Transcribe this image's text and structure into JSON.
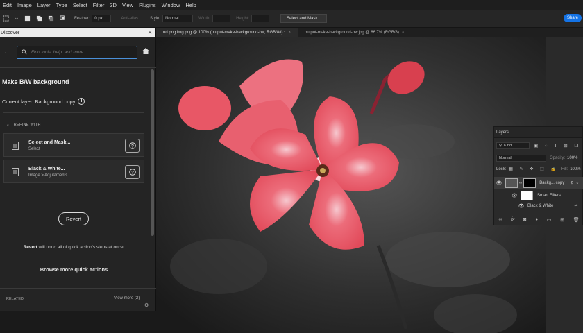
{
  "menu": [
    "Edit",
    "Image",
    "Layer",
    "Type",
    "Select",
    "Filter",
    "3D",
    "View",
    "Plugins",
    "Window",
    "Help"
  ],
  "options": {
    "feather_label": "Feather:",
    "feather_value": "0 px",
    "antialias_label": "Anti-alias",
    "style_label": "Style:",
    "style_value": "Normal",
    "width_label": "Width:",
    "height_label": "Height:",
    "select_mask_button": "Select and Mask...",
    "share_button": "Share"
  },
  "tabs": [
    {
      "label": "nd.png.img.png @ 100% (output-make-background-bw, RGB/8#) *",
      "active": true
    },
    {
      "label": "output-make-background-bw.jpg @ 66.7% (RGB/8)",
      "active": false
    }
  ],
  "discover": {
    "header": "Discover",
    "search_placeholder": "Find tools, help, and more",
    "title": "Make B/W background",
    "current_layer": "Current layer: Background copy",
    "refine_with": "REFINE WITH",
    "cards": [
      {
        "title": "Select and Mask...",
        "subtitle": "Select"
      },
      {
        "title": "Black & White...",
        "subtitle": "Image > Adjustments"
      }
    ],
    "revert_button": "Revert",
    "revert_note_bold": "Revert",
    "revert_note": " will undo all of quick action's steps at once.",
    "browse_more": "Browse more quick actions",
    "related": "RELATED",
    "view_more": "View more (2)"
  },
  "layers": {
    "title": "Layers",
    "kind": "Kind",
    "blend_mode": "Normal",
    "opacity_label": "Opacity:",
    "opacity_value": "100%",
    "lock_label": "Lock:",
    "fill_label": "Fill:",
    "fill_value": "100%",
    "items": [
      {
        "name": "Backg... copy"
      },
      {
        "name": "Smart Filters"
      },
      {
        "name": "Black & White"
      }
    ]
  },
  "colors": {
    "accent": "#1473e6",
    "flower": "#e8505f"
  }
}
